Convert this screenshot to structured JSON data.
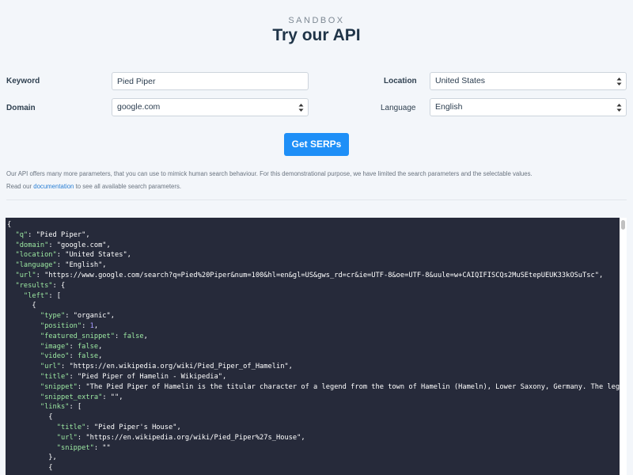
{
  "header": {
    "eyebrow": "SANDBOX",
    "title": "Try our API"
  },
  "form": {
    "keyword": {
      "label": "Keyword",
      "value": "Pied Piper"
    },
    "domain": {
      "label": "Domain",
      "value": "google.com"
    },
    "location": {
      "label": "Location",
      "value": "United States"
    },
    "language": {
      "label": "Language",
      "value": "English"
    },
    "submit_label": "Get SERPs"
  },
  "notes": {
    "line1": "Our API offers many more parameters, that you can use to mimick human search behaviour. For this demonstrational purpose, we have limited the search parameters and the selectable values.",
    "line2_prefix": "Read our ",
    "line2_link": "documentation",
    "line2_suffix": " to see all available search parameters."
  },
  "code_lines": [
    [
      [
        "{",
        "p"
      ]
    ],
    [
      [
        "  \"q\"",
        "k"
      ],
      [
        ": \"Pied Piper\",",
        "s"
      ]
    ],
    [
      [
        "  \"domain\"",
        "k"
      ],
      [
        ": \"google.com\",",
        "s"
      ]
    ],
    [
      [
        "  \"location\"",
        "k"
      ],
      [
        ": \"United States\",",
        "s"
      ]
    ],
    [
      [
        "  \"language\"",
        "k"
      ],
      [
        ": \"English\",",
        "s"
      ]
    ],
    [
      [
        "  \"url\"",
        "k"
      ],
      [
        ": \"https://www.google.com/search?q=Pied%20Piper&num=100&hl=en&gl=US&gws_rd=cr&ie=UTF-8&oe=UTF-8&uule=w+CAIQIFISCQs2MuSEtepUEUK33kOSuTsc\",",
        "s"
      ]
    ],
    [
      [
        "  \"results\"",
        "k"
      ],
      [
        ": {",
        "p"
      ]
    ],
    [
      [
        "    \"left\"",
        "k"
      ],
      [
        ": [",
        "p"
      ]
    ],
    [
      [
        "      {",
        "p"
      ]
    ],
    [
      [
        "        \"type\"",
        "k"
      ],
      [
        ": \"organic\",",
        "s"
      ]
    ],
    [
      [
        "        \"position\"",
        "k"
      ],
      [
        ": ",
        "p"
      ],
      [
        "1",
        "n"
      ],
      [
        ",",
        "p"
      ]
    ],
    [
      [
        "        \"featured_snippet\"",
        "k"
      ],
      [
        ": ",
        "p"
      ],
      [
        "false",
        "bo"
      ],
      [
        ",",
        "p"
      ]
    ],
    [
      [
        "        \"image\"",
        "k"
      ],
      [
        ": ",
        "p"
      ],
      [
        "false",
        "bo"
      ],
      [
        ",",
        "p"
      ]
    ],
    [
      [
        "        \"video\"",
        "k"
      ],
      [
        ": ",
        "p"
      ],
      [
        "false",
        "bo"
      ],
      [
        ",",
        "p"
      ]
    ],
    [
      [
        "        \"url\"",
        "k"
      ],
      [
        ": \"https://en.wikipedia.org/wiki/Pied_Piper_of_Hamelin\",",
        "s"
      ]
    ],
    [
      [
        "        \"title\"",
        "k"
      ],
      [
        ": \"Pied Piper of Hamelin - Wikipedia\",",
        "s"
      ]
    ],
    [
      [
        "        \"snippet\"",
        "k"
      ],
      [
        ": \"The Pied Piper of Hamelin is the titular character of a legend from the town of Hamelin (Hameln), Lower Saxony, Germany. The legend",
        "s"
      ]
    ],
    [
      [
        "        \"snippet_extra\"",
        "k"
      ],
      [
        ": \"\",",
        "s"
      ]
    ],
    [
      [
        "        \"links\"",
        "k"
      ],
      [
        ": [",
        "p"
      ]
    ],
    [
      [
        "          {",
        "p"
      ]
    ],
    [
      [
        "            \"title\"",
        "k"
      ],
      [
        ": \"Pied Piper's House\",",
        "s"
      ]
    ],
    [
      [
        "            \"url\"",
        "k"
      ],
      [
        ": \"https://en.wikipedia.org/wiki/Pied_Piper%27s_House\",",
        "s"
      ]
    ],
    [
      [
        "            \"snippet\"",
        "k"
      ],
      [
        ": \"\"",
        "s"
      ]
    ],
    [
      [
        "          },",
        "p"
      ]
    ],
    [
      [
        "          {",
        "p"
      ]
    ]
  ]
}
